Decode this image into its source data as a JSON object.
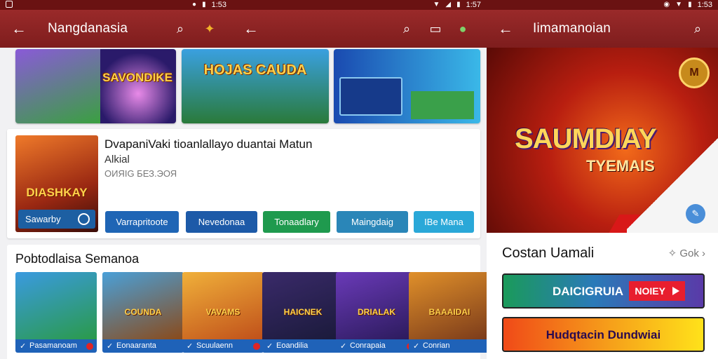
{
  "screen1": {
    "status_time": "1:53",
    "title": "Nangdanasia",
    "icons": [
      "back-arrow-icon",
      "search-icon",
      "lightbulb-icon"
    ]
  },
  "screen2": {
    "status_time": "1:57",
    "icons": [
      "back-arrow-icon",
      "search-icon",
      "chat-icon",
      "game-controller-icon"
    ]
  },
  "screen3": {
    "status_time": "1:53",
    "title": "Iimamanoian",
    "hero_title": "SAUMDIAY",
    "hero_subtitle": "TYEMAIS",
    "hero_badge": "M",
    "section_title": "Costan Uamali",
    "more_label": "Gok",
    "button1_label": "DAICIGRUIA",
    "button1_tag": "NOIEY",
    "button2_label": "Hudqtacin Dundwiai"
  },
  "banners": [
    {
      "title": "SAVONDIKE",
      "colors": [
        "#6a3ab8",
        "#2a1a6a"
      ]
    },
    {
      "title": "HOJAS CAUDA",
      "colors": [
        "#3aa0e0",
        "#2a7a3a"
      ]
    },
    {
      "title": "",
      "colors": [
        "#2a6ad0",
        "#3ab8e8"
      ]
    }
  ],
  "featured_app": {
    "name": "DvapaniVaki  tioanlallayo duantai  Matun",
    "subtitle": "Alkial",
    "meta": "ОИЯIG БЕЗ.ЭОЯ",
    "image_title": "DIASHKAY",
    "install_label": "Sawarby"
  },
  "chips": [
    {
      "label": "Varrapritoote",
      "color": "#1f65b5"
    },
    {
      "label": "Nevedonaa",
      "color": "#1d5aa8"
    },
    {
      "label": "Tonaadlary",
      "color": "#1f9a4e"
    },
    {
      "label": "Maingdaig",
      "color": "#2a86b8"
    },
    {
      "label": "IBe Mana",
      "color": "#2aa8d8"
    }
  ],
  "section": {
    "title": "Pobtodlaisa Semanoa",
    "tiles": [
      {
        "label": "Pasamanoam",
        "title": "",
        "colors": [
          "#3a9ae0",
          "#2a9a4a"
        ]
      },
      {
        "label": "Eonaaranta",
        "title": "COUNDA",
        "colors": [
          "#4aa0d8",
          "#8a4a1a"
        ]
      },
      {
        "label": "Scuulaenn",
        "title": "VAVAMS",
        "colors": [
          "#f0b03a",
          "#c0501a"
        ]
      },
      {
        "label": "Eoandilia",
        "title": "HAICNEK",
        "colors": [
          "#3a2a6a",
          "#1a1a3a"
        ]
      },
      {
        "label": "Conrapaia",
        "title": "DRIALAK",
        "colors": [
          "#6a3ab8",
          "#2a1a5a"
        ]
      },
      {
        "label": "Conrian",
        "title": "BAAAIDAI",
        "colors": [
          "#e0902a",
          "#7a3a1a"
        ]
      }
    ]
  }
}
